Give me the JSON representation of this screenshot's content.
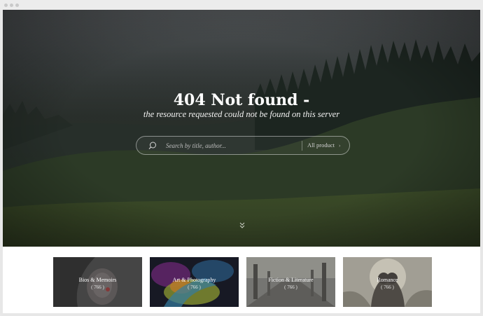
{
  "hero": {
    "title": "404 Not found -",
    "subtitle": "the resource requested could not be found on this server"
  },
  "search": {
    "placeholder": "Search by title, author...",
    "select_value": "All product",
    "select_caret": "›",
    "icon": "search-icon"
  },
  "scroll": {
    "icon": "chevrons-down-icon"
  },
  "categories": [
    {
      "label": "Bios & Memoirs",
      "count": "( 766 )"
    },
    {
      "label": "Art & Photography",
      "count": "( 766 )"
    },
    {
      "label": "Fiction & Literature",
      "count": "( 766 )"
    },
    {
      "label": "Romance",
      "count": "( 766 )"
    }
  ],
  "colors": {
    "hero_text": "#ffffff",
    "window_chrome": "#ececec",
    "page_background": "#ffffff"
  }
}
